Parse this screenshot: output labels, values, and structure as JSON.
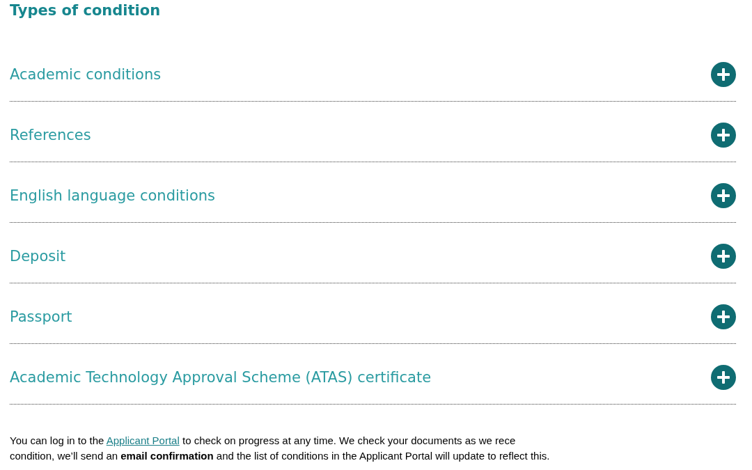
{
  "heading": "Types of condition",
  "accordion": [
    {
      "title": "Academic conditions",
      "expanded": false
    },
    {
      "title": "References",
      "expanded": false
    },
    {
      "title": "English language conditions",
      "expanded": false
    },
    {
      "title": "Deposit",
      "expanded": false
    },
    {
      "title": "Passport",
      "expanded": false
    },
    {
      "title": "Academic Technology Approval Scheme (ATAS) certificate",
      "expanded": false
    }
  ],
  "note": {
    "before": "You can log in to the ",
    "link": "Applicant Portal",
    "after": " to check on progress at any time. We check your documents as we rece",
    "line_2": "condition, we’ll send an **email confirmation** and the list of conditions in the Applicant Portal will update to reflect this."
  }
}
